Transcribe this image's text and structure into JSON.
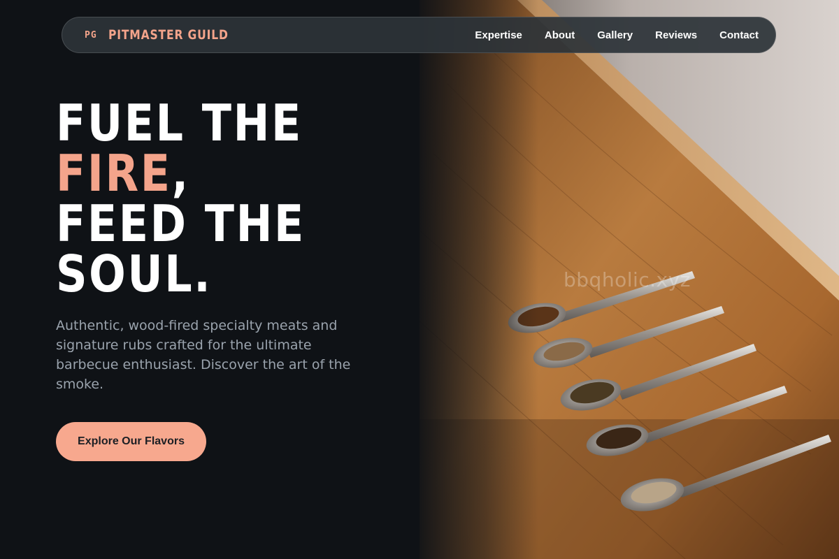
{
  "nav": {
    "brand_mark": "PG",
    "brand_name": "PITMASTER GUILD",
    "links": [
      "Expertise",
      "About",
      "Gallery",
      "Reviews",
      "Contact"
    ]
  },
  "hero": {
    "headline_line1": "FUEL THE",
    "headline_accent": "FIRE",
    "headline_comma": ",",
    "headline_line3": "FEED THE",
    "headline_line4": "SOUL.",
    "subtitle": "Authentic, wood-fired specialty meats and signature rubs crafted for the ultimate barbecue enthusiast. Discover the art of the smoke.",
    "cta_label": "Explore Our Flavors",
    "watermark": "bbqholic.xyz"
  },
  "colors": {
    "background": "#0f1216",
    "accent": "#f4a48b",
    "cta": "#f7a88e",
    "subtitle": "#9aa3ad",
    "wood": "#b5783c"
  }
}
